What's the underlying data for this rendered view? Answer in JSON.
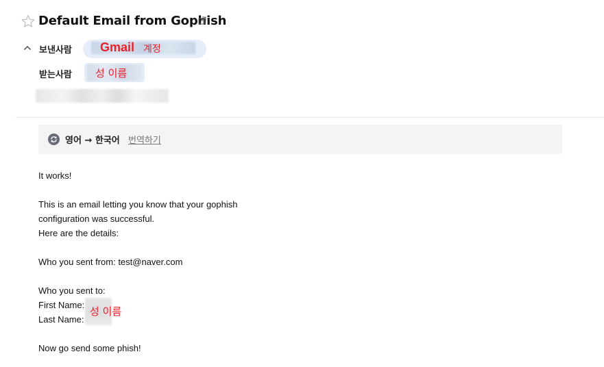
{
  "email": {
    "subject": "Default Email from Gophish",
    "from_label": "보낸사람",
    "to_label": "받는사람",
    "from_annotation_gmail": "Gmail",
    "from_annotation_account": "계정",
    "to_annotation": "성 이름"
  },
  "translate": {
    "direction": "영어 → 한국어",
    "action_label": "번역하기"
  },
  "body": {
    "line1": "It works!",
    "line2": "This is an email letting you know that your gophish",
    "line3": "configuration was successful.",
    "line4": "Here are the details:",
    "line5": "Who you sent from: test@naver.com",
    "line6": "Who you sent to:",
    "first_name_label": "First Name:",
    "last_name_label": "Last Name:",
    "name_annotation": "성 이름",
    "line9": "Now go send some phish!"
  },
  "colors": {
    "annotation_red": "#e8212b",
    "chip_bg": "#e4edf9",
    "translate_bg": "#f4f4f6"
  }
}
